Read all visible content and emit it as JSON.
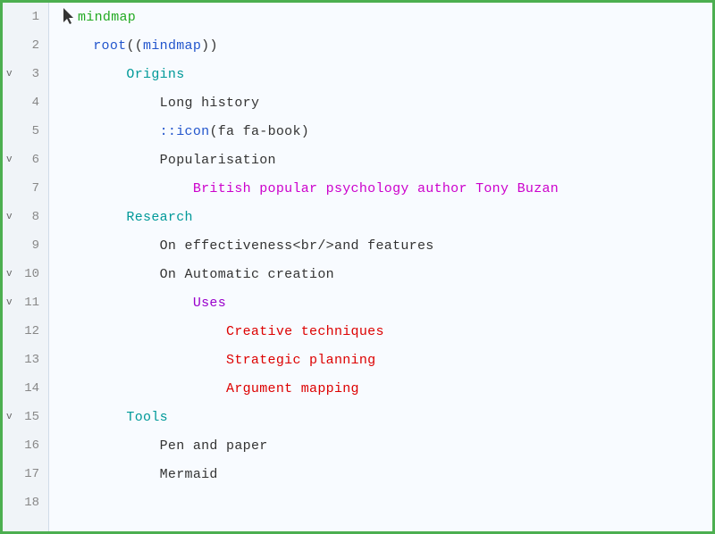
{
  "editor": {
    "border_color": "#4caf50",
    "background": "#f8fbff"
  },
  "lines": [
    {
      "number": 1,
      "chevron": "",
      "cursor": true,
      "segments": [
        {
          "text": "mindmap",
          "color": "c-green"
        }
      ]
    },
    {
      "number": 2,
      "chevron": "",
      "cursor": false,
      "segments": [
        {
          "text": "    ",
          "color": "c-default"
        },
        {
          "text": "root",
          "color": "c-blue"
        },
        {
          "text": "((",
          "color": "c-default"
        },
        {
          "text": "mindmap",
          "color": "c-blue"
        },
        {
          "text": "))",
          "color": "c-default"
        }
      ]
    },
    {
      "number": 3,
      "chevron": "v",
      "cursor": false,
      "segments": [
        {
          "text": "        ",
          "color": "c-default"
        },
        {
          "text": "Origins",
          "color": "c-teal"
        }
      ]
    },
    {
      "number": 4,
      "chevron": "",
      "cursor": false,
      "segments": [
        {
          "text": "            ",
          "color": "c-default"
        },
        {
          "text": "Long history",
          "color": "c-default"
        }
      ]
    },
    {
      "number": 5,
      "chevron": "",
      "cursor": false,
      "segments": [
        {
          "text": "            ",
          "color": "c-default"
        },
        {
          "text": "::",
          "color": "c-blue"
        },
        {
          "text": "icon",
          "color": "c-blue"
        },
        {
          "text": "(fa fa-book)",
          "color": "c-default"
        }
      ]
    },
    {
      "number": 6,
      "chevron": "v",
      "cursor": false,
      "segments": [
        {
          "text": "            ",
          "color": "c-default"
        },
        {
          "text": "Popularisation",
          "color": "c-default"
        }
      ]
    },
    {
      "number": 7,
      "chevron": "",
      "cursor": false,
      "segments": [
        {
          "text": "                ",
          "color": "c-default"
        },
        {
          "text": "British popular psychology author Tony Buzan",
          "color": "c-magenta"
        }
      ]
    },
    {
      "number": 8,
      "chevron": "v",
      "cursor": false,
      "segments": [
        {
          "text": "        ",
          "color": "c-default"
        },
        {
          "text": "Research",
          "color": "c-teal"
        }
      ]
    },
    {
      "number": 9,
      "chevron": "",
      "cursor": false,
      "segments": [
        {
          "text": "            ",
          "color": "c-default"
        },
        {
          "text": "On effectiveness<br/>and features",
          "color": "c-default"
        }
      ]
    },
    {
      "number": 10,
      "chevron": "v",
      "cursor": false,
      "segments": [
        {
          "text": "            ",
          "color": "c-default"
        },
        {
          "text": "On Automatic creation",
          "color": "c-default"
        }
      ]
    },
    {
      "number": 11,
      "chevron": "v",
      "cursor": false,
      "segments": [
        {
          "text": "                ",
          "color": "c-default"
        },
        {
          "text": "Uses",
          "color": "c-purple"
        }
      ]
    },
    {
      "number": 12,
      "chevron": "",
      "cursor": false,
      "segments": [
        {
          "text": "                    ",
          "color": "c-default"
        },
        {
          "text": "Creative techniques",
          "color": "c-red"
        }
      ]
    },
    {
      "number": 13,
      "chevron": "",
      "cursor": false,
      "segments": [
        {
          "text": "                    ",
          "color": "c-default"
        },
        {
          "text": "Strategic planning",
          "color": "c-red"
        }
      ]
    },
    {
      "number": 14,
      "chevron": "",
      "cursor": false,
      "segments": [
        {
          "text": "                    ",
          "color": "c-default"
        },
        {
          "text": "Argument mapping",
          "color": "c-red"
        }
      ]
    },
    {
      "number": 15,
      "chevron": "v",
      "cursor": false,
      "segments": [
        {
          "text": "        ",
          "color": "c-default"
        },
        {
          "text": "Tools",
          "color": "c-teal"
        }
      ]
    },
    {
      "number": 16,
      "chevron": "",
      "cursor": false,
      "segments": [
        {
          "text": "            ",
          "color": "c-default"
        },
        {
          "text": "Pen and paper",
          "color": "c-default"
        }
      ]
    },
    {
      "number": 17,
      "chevron": "",
      "cursor": false,
      "segments": [
        {
          "text": "            ",
          "color": "c-default"
        },
        {
          "text": "Mermaid",
          "color": "c-default"
        }
      ]
    },
    {
      "number": 18,
      "chevron": "",
      "cursor": false,
      "segments": []
    }
  ]
}
